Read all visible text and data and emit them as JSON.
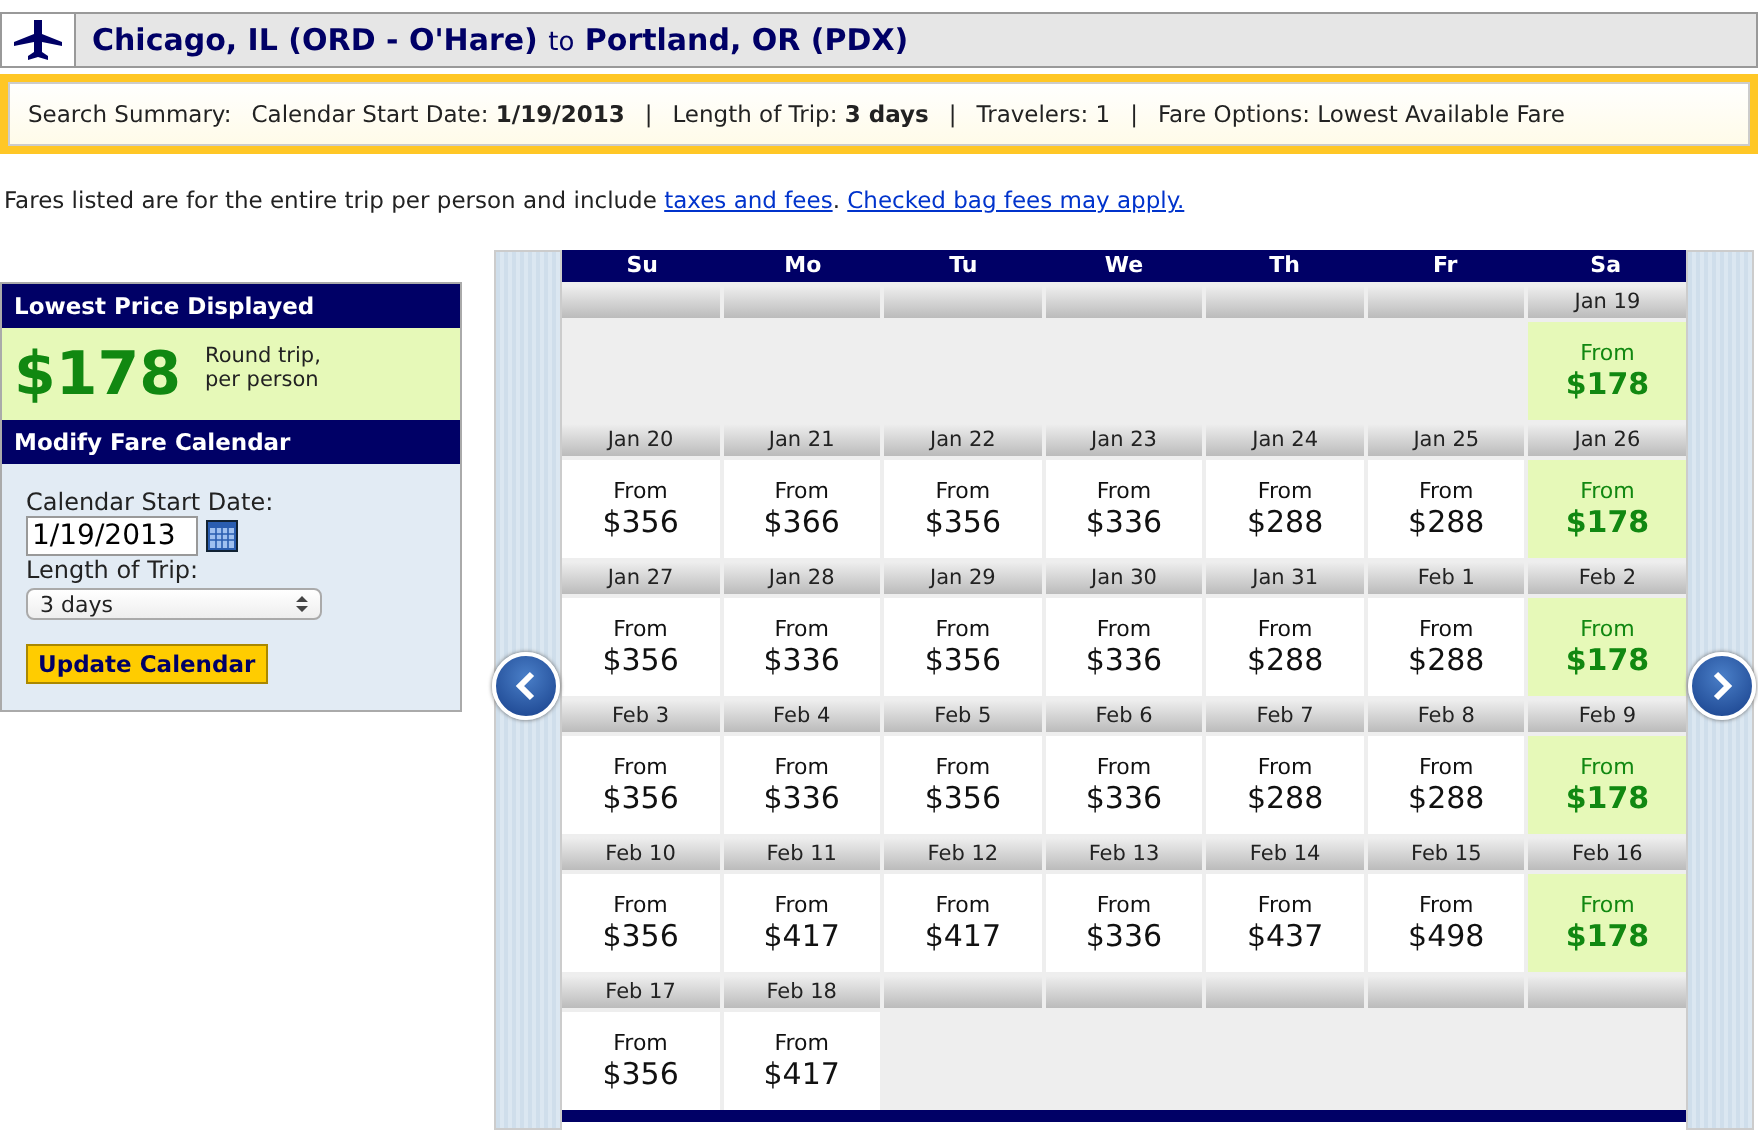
{
  "route": {
    "origin": "Chicago, IL (ORD - O'Hare)",
    "connector": "to",
    "destination": "Portland, OR (PDX)"
  },
  "summary": {
    "label": "Search Summary:",
    "items": [
      {
        "label": "Calendar Start Date:",
        "value": "1/19/2013"
      },
      {
        "label": "Length of Trip:",
        "value": "3 days"
      },
      {
        "label": "Travelers: 1"
      },
      {
        "label": "Fare Options: Lowest Available Fare"
      }
    ],
    "separator": "|"
  },
  "notice": {
    "text": "Fares listed are for the entire trip per person and include ",
    "link1": "taxes and fees",
    "middle": ". ",
    "link2": "Checked bag fees may apply."
  },
  "lowest_price": {
    "title": "Lowest Price Displayed",
    "price": "$178",
    "note": "Round trip, per person"
  },
  "modify": {
    "title": "Modify Fare Calendar",
    "start_label": "Calendar Start Date:",
    "start_value": "1/19/2013",
    "length_label": "Length of Trip:",
    "length_value": "3 days",
    "button": "Update Calendar"
  },
  "calendar": {
    "weekdays": [
      "Su",
      "Mo",
      "Tu",
      "We",
      "Th",
      "Fr",
      "Sa"
    ],
    "weeks": [
      [
        {
          "kind": "empty"
        },
        {
          "kind": "empty"
        },
        {
          "kind": "empty"
        },
        {
          "kind": "empty"
        },
        {
          "kind": "empty"
        },
        {
          "kind": "empty"
        },
        {
          "kind": "fare",
          "date": "Jan 19",
          "from": "From",
          "price": "$178",
          "lowest": true
        }
      ],
      [
        {
          "kind": "fare",
          "date": "Jan 20",
          "from": "From",
          "price": "$356",
          "lowest": false
        },
        {
          "kind": "fare",
          "date": "Jan 21",
          "from": "From",
          "price": "$366",
          "lowest": false
        },
        {
          "kind": "fare",
          "date": "Jan 22",
          "from": "From",
          "price": "$356",
          "lowest": false
        },
        {
          "kind": "fare",
          "date": "Jan 23",
          "from": "From",
          "price": "$336",
          "lowest": false
        },
        {
          "kind": "fare",
          "date": "Jan 24",
          "from": "From",
          "price": "$288",
          "lowest": false
        },
        {
          "kind": "fare",
          "date": "Jan 25",
          "from": "From",
          "price": "$288",
          "lowest": false
        },
        {
          "kind": "fare",
          "date": "Jan 26",
          "from": "From",
          "price": "$178",
          "lowest": true
        }
      ],
      [
        {
          "kind": "fare",
          "date": "Jan 27",
          "from": "From",
          "price": "$356",
          "lowest": false
        },
        {
          "kind": "fare",
          "date": "Jan 28",
          "from": "From",
          "price": "$336",
          "lowest": false
        },
        {
          "kind": "fare",
          "date": "Jan 29",
          "from": "From",
          "price": "$356",
          "lowest": false
        },
        {
          "kind": "fare",
          "date": "Jan 30",
          "from": "From",
          "price": "$336",
          "lowest": false
        },
        {
          "kind": "fare",
          "date": "Jan 31",
          "from": "From",
          "price": "$288",
          "lowest": false
        },
        {
          "kind": "fare",
          "date": "Feb 1",
          "from": "From",
          "price": "$288",
          "lowest": false
        },
        {
          "kind": "fare",
          "date": "Feb 2",
          "from": "From",
          "price": "$178",
          "lowest": true
        }
      ],
      [
        {
          "kind": "fare",
          "date": "Feb 3",
          "from": "From",
          "price": "$356",
          "lowest": false
        },
        {
          "kind": "fare",
          "date": "Feb 4",
          "from": "From",
          "price": "$336",
          "lowest": false
        },
        {
          "kind": "fare",
          "date": "Feb 5",
          "from": "From",
          "price": "$356",
          "lowest": false
        },
        {
          "kind": "fare",
          "date": "Feb 6",
          "from": "From",
          "price": "$336",
          "lowest": false
        },
        {
          "kind": "fare",
          "date": "Feb 7",
          "from": "From",
          "price": "$288",
          "lowest": false
        },
        {
          "kind": "fare",
          "date": "Feb 8",
          "from": "From",
          "price": "$288",
          "lowest": false
        },
        {
          "kind": "fare",
          "date": "Feb 9",
          "from": "From",
          "price": "$178",
          "lowest": true
        }
      ],
      [
        {
          "kind": "fare",
          "date": "Feb 10",
          "from": "From",
          "price": "$356",
          "lowest": false
        },
        {
          "kind": "fare",
          "date": "Feb 11",
          "from": "From",
          "price": "$417",
          "lowest": false
        },
        {
          "kind": "fare",
          "date": "Feb 12",
          "from": "From",
          "price": "$417",
          "lowest": false
        },
        {
          "kind": "fare",
          "date": "Feb 13",
          "from": "From",
          "price": "$336",
          "lowest": false
        },
        {
          "kind": "fare",
          "date": "Feb 14",
          "from": "From",
          "price": "$437",
          "lowest": false
        },
        {
          "kind": "fare",
          "date": "Feb 15",
          "from": "From",
          "price": "$498",
          "lowest": false
        },
        {
          "kind": "fare",
          "date": "Feb 16",
          "from": "From",
          "price": "$178",
          "lowest": true
        }
      ],
      [
        {
          "kind": "fare",
          "date": "Feb 17",
          "from": "From",
          "price": "$356",
          "lowest": false
        },
        {
          "kind": "fare",
          "date": "Feb 18",
          "from": "From",
          "price": "$417",
          "lowest": false
        },
        {
          "kind": "empty"
        },
        {
          "kind": "empty"
        },
        {
          "kind": "empty"
        },
        {
          "kind": "empty"
        },
        {
          "kind": "empty"
        }
      ]
    ]
  }
}
